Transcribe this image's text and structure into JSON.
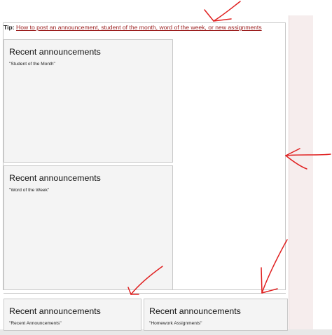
{
  "tip": {
    "label": "Tip:",
    "link_text": "How to post an announcement, student of the month, word of the week, or new assignments"
  },
  "cards": [
    {
      "title": "Recent announcements",
      "subtitle": "\"Student of the Month\""
    },
    {
      "title": "Recent announcements",
      "subtitle": "\"Word of the Week\""
    },
    {
      "title": "Recent announcements",
      "subtitle": "\"Recent Announcements\""
    },
    {
      "title": "Recent announcements",
      "subtitle": "\"Homework Assignments\""
    }
  ],
  "colors": {
    "link": "#9a1c1c",
    "annotation_arrow": "#e02020",
    "card_background": "#f4f4f4",
    "gutter_background": "#f6eded"
  },
  "annotations": {
    "icon": "red-hand-drawn-arrow",
    "count": 5
  }
}
